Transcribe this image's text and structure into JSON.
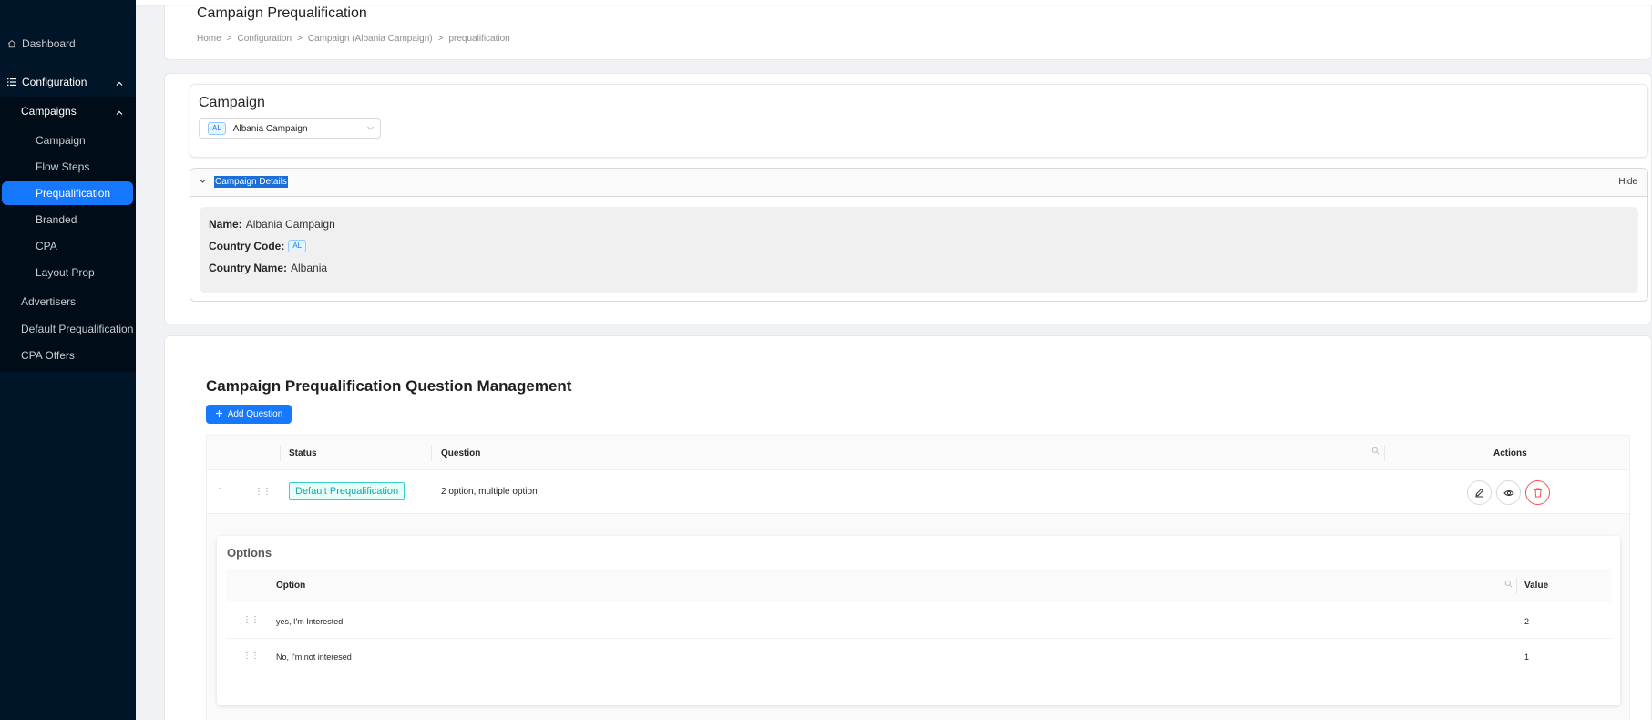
{
  "sidebar": {
    "dashboard": "Dashboard",
    "configuration": "Configuration",
    "campaigns": "Campaigns",
    "sub_items": [
      "Campaign",
      "Flow Steps",
      "Prequalification",
      "Branded",
      "CPA",
      "Layout Prop"
    ],
    "bottom_items": [
      "Advertisers",
      "Default Prequalification",
      "CPA Offers"
    ]
  },
  "header": {
    "title": "Campaign Prequalification",
    "breadcrumb": [
      "Home",
      "Configuration",
      "Campaign (Albania Campaign)",
      "prequalification"
    ],
    "separator": ">"
  },
  "campaign_select": {
    "label": "Campaign",
    "tag": "AL",
    "value": "Albania Campaign"
  },
  "details": {
    "title": "Campaign Details",
    "hide": "Hide",
    "name_label": "Name:",
    "name_value": "Albania Campaign",
    "country_code_label": "Country Code:",
    "country_code_value": "AL",
    "country_name_label": "Country Name:",
    "country_name_value": "Albania"
  },
  "questions": {
    "title": "Campaign Prequalification Question Management",
    "add_button": "Add Question",
    "columns": {
      "status": "Status",
      "question": "Question",
      "actions": "Actions"
    },
    "rows": [
      {
        "collapse": "-",
        "status": "Default Prequalification",
        "question": "2 option, multiple option"
      }
    ]
  },
  "options": {
    "title": "Options",
    "columns": {
      "option": "Option",
      "value": "Value"
    },
    "rows": [
      {
        "option": "yes, I'm Interested",
        "value": "2"
      },
      {
        "option": "No, I'm not interesed",
        "value": "1"
      }
    ]
  }
}
